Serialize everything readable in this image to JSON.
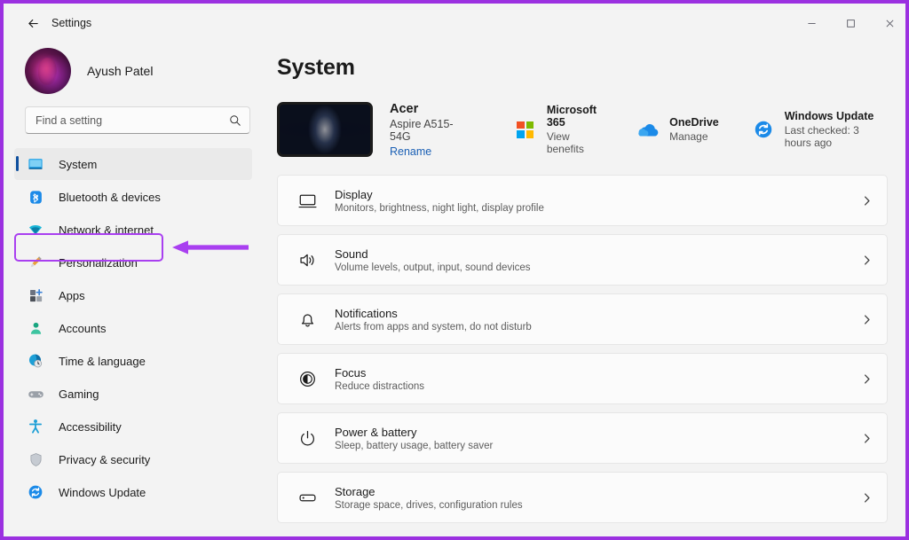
{
  "window": {
    "title": "Settings",
    "back_icon": "back-arrow-icon",
    "controls": [
      {
        "name": "minimize-button",
        "glyph": "minimize-icon"
      },
      {
        "name": "maximize-button",
        "glyph": "maximize-icon"
      },
      {
        "name": "close-button",
        "glyph": "close-icon"
      }
    ]
  },
  "sidebar": {
    "profile": {
      "name": "Ayush Patel",
      "avatar_icon": "user-avatar"
    },
    "search": {
      "placeholder": "Find a setting",
      "icon": "search-icon"
    },
    "items": [
      {
        "label": "System",
        "icon": "monitor-icon",
        "selected": true
      },
      {
        "label": "Bluetooth & devices",
        "icon": "bluetooth-icon",
        "selected": false
      },
      {
        "label": "Network & internet",
        "icon": "wifi-icon",
        "selected": false,
        "annotated": true
      },
      {
        "label": "Personalization",
        "icon": "paintbrush-icon",
        "selected": false
      },
      {
        "label": "Apps",
        "icon": "apps-icon",
        "selected": false
      },
      {
        "label": "Accounts",
        "icon": "person-icon",
        "selected": false
      },
      {
        "label": "Time & language",
        "icon": "clock-globe-icon",
        "selected": false
      },
      {
        "label": "Gaming",
        "icon": "gamepad-icon",
        "selected": false
      },
      {
        "label": "Accessibility",
        "icon": "accessibility-icon",
        "selected": false
      },
      {
        "label": "Privacy & security",
        "icon": "shield-icon",
        "selected": false
      },
      {
        "label": "Windows Update",
        "icon": "update-refresh-icon",
        "selected": false
      }
    ]
  },
  "main": {
    "page_title": "System",
    "device": {
      "name": "Acer",
      "model": "Aspire A515-54G",
      "rename_label": "Rename",
      "thumbnail_icon": "laptop-wallpaper-thumbnail"
    },
    "quick_links": [
      {
        "title": "Microsoft 365",
        "subtitle": "View benefits",
        "icon": "microsoft-logo-icon"
      },
      {
        "title": "OneDrive",
        "subtitle": "Manage",
        "icon": "onedrive-cloud-icon"
      },
      {
        "title": "Windows Update",
        "subtitle": "Last checked: 3 hours ago",
        "icon": "update-refresh-icon"
      }
    ],
    "cards": [
      {
        "title": "Display",
        "subtitle": "Monitors, brightness, night light, display profile",
        "icon": "monitor-icon"
      },
      {
        "title": "Sound",
        "subtitle": "Volume levels, output, input, sound devices",
        "icon": "speaker-icon"
      },
      {
        "title": "Notifications",
        "subtitle": "Alerts from apps and system, do not disturb",
        "icon": "bell-icon"
      },
      {
        "title": "Focus",
        "subtitle": "Reduce distractions",
        "icon": "focus-moon-icon"
      },
      {
        "title": "Power & battery",
        "subtitle": "Sleep, battery usage, battery saver",
        "icon": "power-icon"
      },
      {
        "title": "Storage",
        "subtitle": "Storage space, drives, configuration rules",
        "icon": "storage-drive-icon"
      }
    ],
    "chevron_icon": "chevron-right-icon"
  },
  "annotation": {
    "highlight_color": "#a93ff0",
    "frame_color": "#9b30e0",
    "target_label": "Network & internet"
  }
}
